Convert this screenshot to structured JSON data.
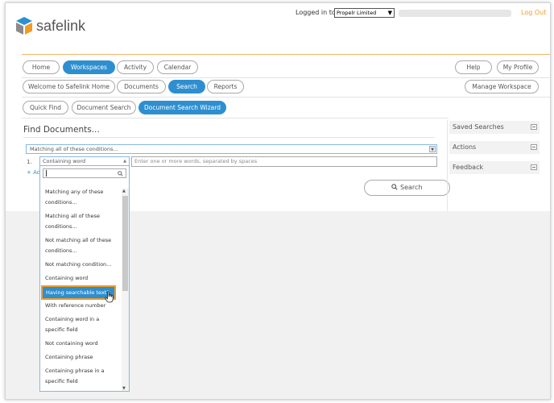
{
  "header": {
    "logo_text": "safelink",
    "logged_in_label": "Logged in to",
    "company_select": "Propelr Limited",
    "logout_label": "Log Out",
    "brand_color": "#2e8fd0",
    "accent_color": "#f59a23"
  },
  "nav": {
    "row1": [
      "Home",
      "Workspaces",
      "Activity",
      "Calendar"
    ],
    "row1_right": [
      "Help",
      "My Profile"
    ],
    "row2": [
      "Welcome to Safelink Home",
      "Documents",
      "Search",
      "Reports"
    ],
    "row2_right": "Manage Workspace",
    "row3": [
      "Quick Find",
      "Document Search",
      "Document Search Wizard"
    ]
  },
  "main": {
    "title": "Find Documents...",
    "matching_select": "Matching all of these conditions...",
    "condition_number": "1.",
    "condition_select": "Containing word",
    "condition_placeholder": "Enter one or more words, separated by spaces",
    "add_link": "+ Ad",
    "search_button": "Search"
  },
  "dropdown": {
    "options": [
      "Matching any of these conditions...",
      "Matching all of these conditions...",
      "Not matching all of these conditions...",
      "Not matching condition...",
      "Containing word",
      "Having searchable text?",
      "With reference number",
      "Containing word in a specific field",
      "Not containing word",
      "Containing phrase",
      "Containing phrase in a specific field"
    ],
    "highlighted": "Having searchable text?"
  },
  "sidebar": {
    "items": [
      "Saved Searches",
      "Actions",
      "Feedback"
    ]
  },
  "icons": {
    "search": "search-icon",
    "cursor": "hand-cursor-icon",
    "collapse": "collapse-icon",
    "dropdown_arrow": "chevron-down-icon"
  }
}
